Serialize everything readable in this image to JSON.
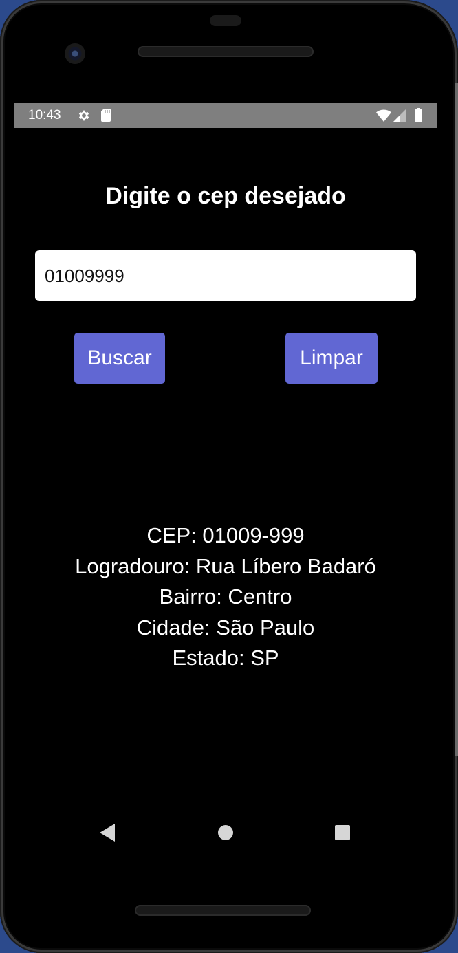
{
  "status_bar": {
    "time": "10:43",
    "icons": [
      "gear-icon",
      "sd-card-icon",
      "wifi-icon",
      "cell-signal-icon",
      "battery-icon"
    ]
  },
  "main": {
    "title": "Digite o cep desejado",
    "cep_input": {
      "value": "01009999",
      "placeholder": ""
    },
    "buttons": {
      "search_label": "Buscar",
      "clear_label": "Limpar"
    },
    "result": {
      "cep": "CEP: 01009-999",
      "logradouro": "Logradouro: Rua Líbero Badaró",
      "bairro": "Bairro: Centro",
      "cidade": "Cidade: São Paulo",
      "estado": "Estado: SP"
    }
  },
  "nav_bar": {
    "icons": [
      "back-icon",
      "home-icon",
      "recents-icon"
    ]
  },
  "colors": {
    "background": "#000000",
    "status_bar": "#7f7f7f",
    "button": "#6167d3",
    "text": "#ffffff",
    "input_background": "#ffffff"
  }
}
